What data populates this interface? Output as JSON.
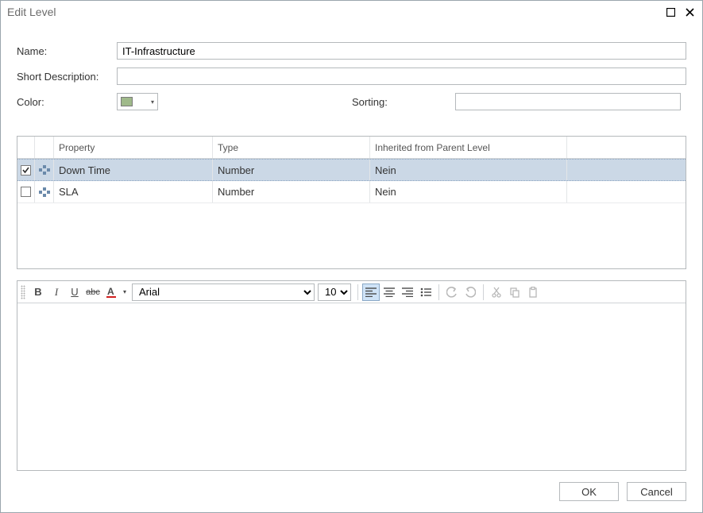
{
  "window": {
    "title": "Edit Level",
    "maximize_label": "maximize",
    "close_label": "close"
  },
  "form": {
    "name_label": "Name:",
    "name_value": "IT-Infrastructure",
    "short_desc_label": "Short Description:",
    "short_desc_value": "",
    "color_label": "Color:",
    "color_hex": "#9fb98a",
    "sorting_label": "Sorting:",
    "sorting_value": ""
  },
  "table": {
    "headers": {
      "property": "Property",
      "type": "Type",
      "inherited": "Inherited from Parent Level"
    },
    "rows": [
      {
        "checked": true,
        "property": "Down Time",
        "type": "Number",
        "inherited": "Nein"
      },
      {
        "checked": false,
        "property": "SLA",
        "type": "Number",
        "inherited": "Nein"
      }
    ]
  },
  "editor": {
    "font": "Arial",
    "size": "10",
    "content": ""
  },
  "footer": {
    "ok": "OK",
    "cancel": "Cancel"
  }
}
